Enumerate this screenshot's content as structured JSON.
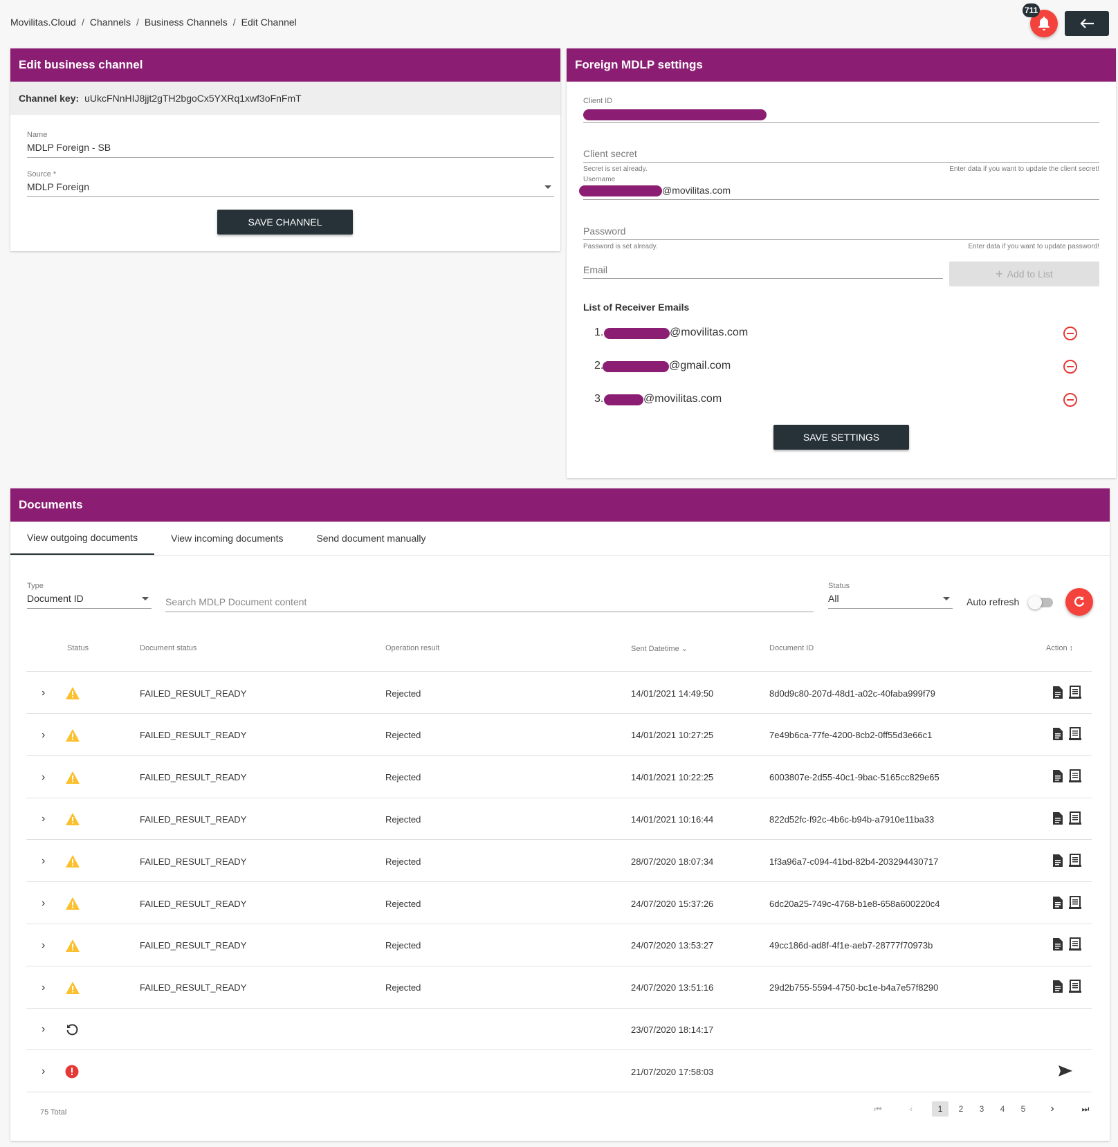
{
  "breadcrumb": [
    "Movilitas.Cloud",
    "Channels",
    "Business Channels",
    "Edit Channel"
  ],
  "notifications": {
    "count": "711"
  },
  "edit_channel": {
    "title": "Edit business channel",
    "key_label": "Channel key:",
    "key_value": "uUkcFNnHIJ8jjt2gTH2bgoCx5YXRq1xwf3oFnFmT",
    "name_label": "Name",
    "name_value": "MDLP Foreign - SB",
    "source_label": "Source *",
    "source_value": "MDLP Foreign",
    "save_label": "SAVE CHANNEL"
  },
  "mdlp": {
    "title": "Foreign MDLP settings",
    "client_id_label": "Client ID",
    "client_secret_label": "Client secret",
    "secret_hint_left": "Secret is set already.",
    "secret_hint_right": "Enter data if you want to update the client secret!",
    "username_label": "Username",
    "username_suffix": "@movilitas.com",
    "password_label": "Password",
    "password_hint_left": "Password is set already.",
    "password_hint_right": "Enter data if you want to update password!",
    "email_placeholder": "Email",
    "add_label": "Add to List",
    "list_title": "List of Receiver Emails",
    "emails": [
      {
        "num": "1.",
        "domain": "@movilitas.com"
      },
      {
        "num": "2.",
        "domain": "@gmail.com"
      },
      {
        "num": "3.",
        "domain": "@movilitas.com"
      }
    ],
    "save_label": "SAVE SETTINGS"
  },
  "documents": {
    "title": "Documents",
    "tabs": [
      "View outgoing documents",
      "View incoming documents",
      "Send document manually"
    ],
    "type_label": "Type",
    "type_value": "Document ID",
    "search_placeholder": "Search MDLP Document content",
    "status_label": "Status",
    "status_value": "All",
    "auto_refresh_label": "Auto refresh",
    "columns": [
      "Status",
      "Document status",
      "Operation result",
      "Sent Datetime",
      "Document ID",
      "Action"
    ],
    "rows": [
      {
        "icon": "warning",
        "doc_status": "FAILED_RESULT_READY",
        "result": "Rejected",
        "datetime": "14/01/2021 14:49:50",
        "doc_id": "8d0d9c80-207d-48d1-a02c-40faba999f79"
      },
      {
        "icon": "warning",
        "doc_status": "FAILED_RESULT_READY",
        "result": "Rejected",
        "datetime": "14/01/2021 10:27:25",
        "doc_id": "7e49b6ca-77fe-4200-8cb2-0ff55d3e66c1"
      },
      {
        "icon": "warning",
        "doc_status": "FAILED_RESULT_READY",
        "result": "Rejected",
        "datetime": "14/01/2021 10:22:25",
        "doc_id": "6003807e-2d55-40c1-9bac-5165cc829e65"
      },
      {
        "icon": "warning",
        "doc_status": "FAILED_RESULT_READY",
        "result": "Rejected",
        "datetime": "14/01/2021 10:16:44",
        "doc_id": "822d52fc-f92c-4b6c-b94b-a7910e11ba33"
      },
      {
        "icon": "warning",
        "doc_status": "FAILED_RESULT_READY",
        "result": "Rejected",
        "datetime": "28/07/2020 18:07:34",
        "doc_id": "1f3a96a7-c094-41bd-82b4-203294430717"
      },
      {
        "icon": "warning",
        "doc_status": "FAILED_RESULT_READY",
        "result": "Rejected",
        "datetime": "24/07/2020 15:37:26",
        "doc_id": "6dc20a25-749c-4768-b1e8-658a600220c4"
      },
      {
        "icon": "warning",
        "doc_status": "FAILED_RESULT_READY",
        "result": "Rejected",
        "datetime": "24/07/2020 13:53:27",
        "doc_id": "49cc186d-ad8f-4f1e-aeb7-28777f70973b"
      },
      {
        "icon": "warning",
        "doc_status": "FAILED_RESULT_READY",
        "result": "Rejected",
        "datetime": "24/07/2020 13:51:16",
        "doc_id": "29d2b755-5594-4750-bc1e-b4a7e57f8290"
      },
      {
        "icon": "pending",
        "doc_status": "",
        "result": "",
        "datetime": "23/07/2020 18:14:17",
        "doc_id": ""
      },
      {
        "icon": "error",
        "doc_status": "",
        "result": "",
        "datetime": "21/07/2020 17:58:03",
        "doc_id": ""
      }
    ],
    "total": "75 Total",
    "pages": [
      "1",
      "2",
      "3",
      "4",
      "5"
    ]
  },
  "colors": {
    "brand": "#8b1e73",
    "dark": "#263238",
    "accent": "#f4433c",
    "warning": "#fbc02d",
    "error": "#e53935"
  }
}
